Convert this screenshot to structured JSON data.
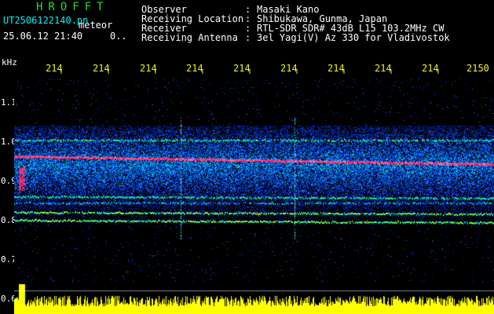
{
  "header": {
    "app_title": "HROFFT",
    "file_name": "UT2506122140.pn",
    "file_suffix": "meteor",
    "date_time": "25.06.12 21:40",
    "date_extra": "0.."
  },
  "info": [
    {
      "label": "Observer",
      "value": "Masaki Kano"
    },
    {
      "label": "Receiving Location",
      "value": "Shibukawa, Gunma, Japan"
    },
    {
      "label": "Receiver",
      "value": "RTL-SDR SDR# 43dB L15 103.2MHz CW"
    },
    {
      "label": "Receiving Antenna",
      "value": "3el Yagi(V) Az 330 for Vladivostok"
    }
  ],
  "info_separator": ":",
  "axis": {
    "unit_label": "kHz",
    "x_ticks": [
      "214",
      "214",
      "214",
      "214",
      "214",
      "214",
      "214",
      "214",
      "214",
      "2150"
    ],
    "y_ticks": [
      "1.1",
      "1.0",
      "0.9",
      "0.8",
      "0.7",
      "0.6"
    ]
  },
  "colors": {
    "title": "#22e02a",
    "info_text": "#00f2ff",
    "tick_text": "#f2f21a",
    "background": "#000000",
    "echo_trace": "#ff2a6a",
    "noise_floor": "#ffff00"
  }
}
